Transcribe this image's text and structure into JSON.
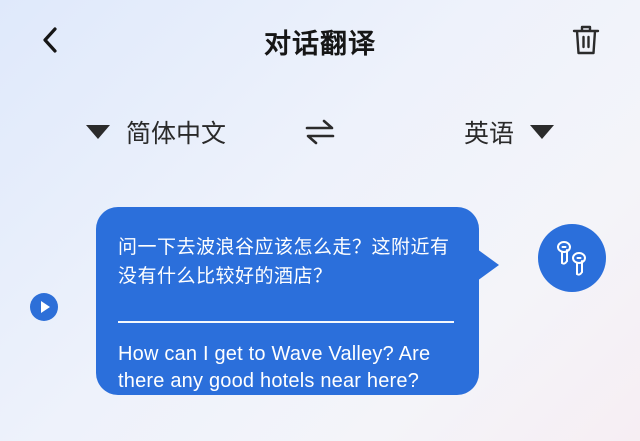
{
  "header": {
    "title": "对话翻译",
    "back_icon": "chevron-left-icon",
    "trash_icon": "trash-icon"
  },
  "languages": {
    "source": "简体中文",
    "target": "英语",
    "swap_icon": "swap-arrows-icon"
  },
  "message": {
    "source_text": "问一下去波浪谷应该怎么走？这附近有没有什么比较好的酒店？",
    "translation": "How can I get to Wave Valley? Are there any good hotels near here?",
    "play_icon": "play-icon",
    "earbuds_icon": "earbuds-icon"
  },
  "colors": {
    "accent": "#2b6fdb",
    "text": "#161616"
  }
}
